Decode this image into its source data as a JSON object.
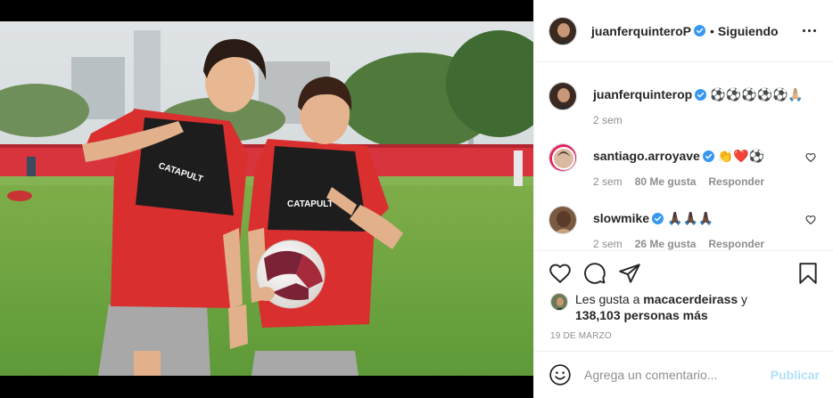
{
  "post": {
    "author": "juanferquinteroP",
    "follow_status": "Siguiendo",
    "header_separator": "•"
  },
  "comments": [
    {
      "user": "juanferquinterop",
      "verified": true,
      "text": "⚽⚽⚽⚽⚽🙏🏼",
      "time": "2 sem",
      "likes": "",
      "reply": ""
    },
    {
      "user": "santiago.arroyave",
      "verified": true,
      "text": "👏❤️⚽",
      "time": "2 sem",
      "likes": "80 Me gusta",
      "reply": "Responder"
    },
    {
      "user": "slowmike",
      "verified": true,
      "text": "🙏🏿🙏🏿🙏🏿",
      "time": "2 sem",
      "likes": "26 Me gusta",
      "reply": "Responder"
    }
  ],
  "likes": {
    "prefix": "Les gusta a",
    "liker": "macacerdeirass",
    "connector": "y",
    "count_text": "138,103 personas más"
  },
  "date": "19 DE MARZO",
  "comment_box": {
    "placeholder": "Agrega un comentario...",
    "publish_label": "Publicar"
  },
  "photo": {
    "bib_text_left": "CATAPULT",
    "bib_text_right": "CATAPULT"
  },
  "icons": {
    "like": "heart-outline-icon",
    "comment": "speech-bubble-icon",
    "share": "paper-plane-icon",
    "save": "bookmark-icon",
    "more": "ellipsis-icon",
    "emoji": "smiley-icon",
    "verified": "verified-badge-icon"
  },
  "colors": {
    "verified": "#3897f0",
    "publish_disabled": "#b2dffc",
    "secondary_text": "#8e8e8e",
    "primary_text": "#262626"
  }
}
